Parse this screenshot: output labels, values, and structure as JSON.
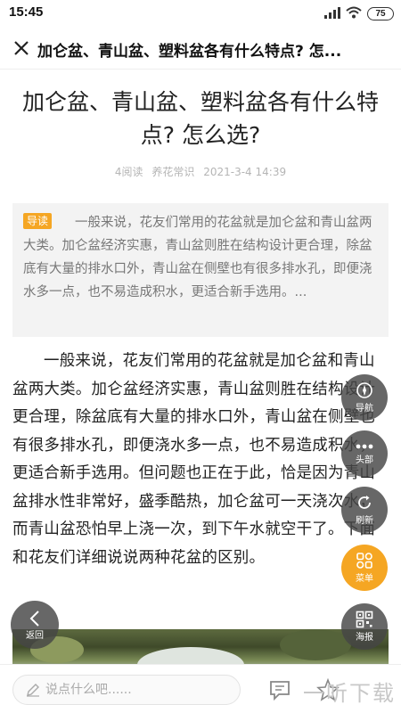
{
  "status_bar": {
    "time": "15:45",
    "battery": "75"
  },
  "title_bar": {
    "title": "加仑盆、青山盆、塑料盆各有什么特点? 怎..."
  },
  "article": {
    "title": "加仑盆、青山盆、塑料盆各有什么特点? 怎么选?",
    "meta": {
      "reads": "4阅读",
      "source": "养花常识",
      "date": "2021-3-4 14:39"
    },
    "summary": {
      "tag": "导读",
      "text": "一般来说，花友们常用的花盆就是加仑盆和青山盆两大类。加仑盆经济实惠，青山盆则胜在结构设计更合理，除盆底有大量的排水口外，青山盆在侧壁也有很多排水孔，即便浇水多一点，也不易造成积水，更适合新手选用。..."
    },
    "body": "一般来说，花友们常用的花盆就是加仑盆和青山盆两大类。加仑盆经济实惠，青山盆则胜在结构设计更合理，除盆底有大量的排水口外，青山盆在侧壁也有很多排水孔，即便浇水多一点，也不易造成积水，更适合新手选用。但问题也正在于此，恰是因为青山盆排水性非常好，盛季酷热，加仑盆可一天浇次水，而青山盆恐怕早上浇一次，到下午水就空干了。下面和花友们详细说说两种花盆的区别。"
  },
  "float_menu": {
    "nav": "导航",
    "top": "头部",
    "refresh": "刷新",
    "menu": "菜单",
    "poster": "海报",
    "back": "返回"
  },
  "bottom_bar": {
    "comment_placeholder": "说点什么吧......",
    "watermark": "一听下载"
  },
  "colors": {
    "accent": "#f5a623",
    "float_bg": "#464646"
  }
}
